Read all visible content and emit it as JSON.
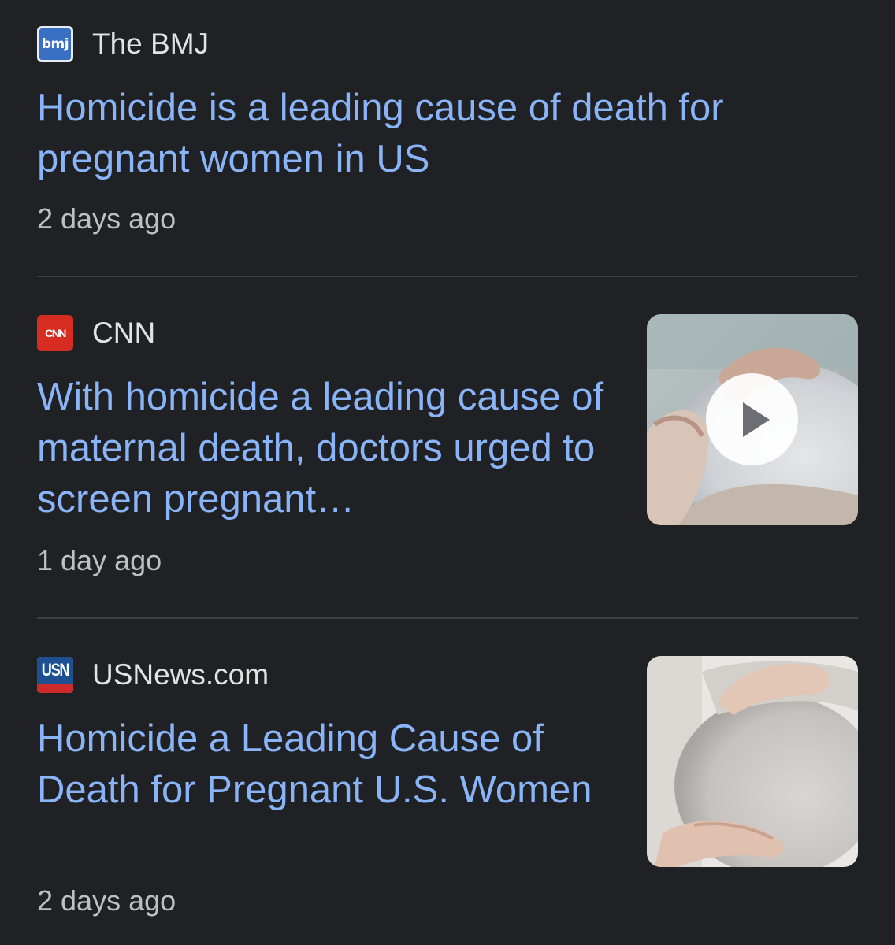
{
  "articles": [
    {
      "source": "The BMJ",
      "favicon_text": "bmj",
      "favicon_icon": "bmj-logo-icon",
      "headline": "Homicide is a leading cause of death for pregnant women in US",
      "time": "2 days ago",
      "has_thumbnail": false
    },
    {
      "source": "CNN",
      "favicon_text": "CNN",
      "favicon_icon": "cnn-logo-icon",
      "headline": "With homicide a leading cause of maternal death, doctors urged to screen pregnant…",
      "time": "1 day ago",
      "has_thumbnail": true,
      "thumbnail_is_video": true
    },
    {
      "source": "USNews.com",
      "favicon_text": "USN",
      "favicon_icon": "usnews-logo-icon",
      "headline": "Homicide a Leading Cause of Death for Pregnant U.S. Women",
      "time": "2 days ago",
      "has_thumbnail": true,
      "thumbnail_is_video": false
    }
  ],
  "colors": {
    "background": "#202124",
    "headline": "#8ab4f8",
    "source": "#e3e3e3",
    "timestamp": "#bdc1c6",
    "divider": "#3c4043"
  }
}
